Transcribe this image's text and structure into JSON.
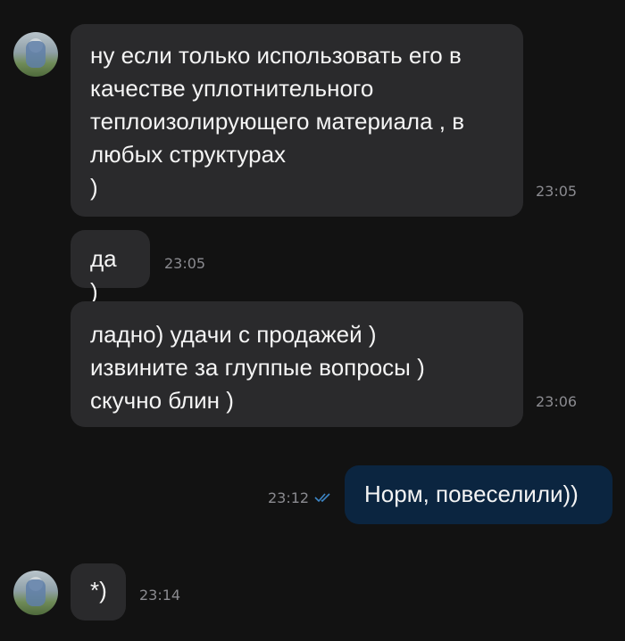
{
  "messages": [
    {
      "text": "ну если только использовать его в\nкачестве уплотнительного\nтеплоизолирующего материала , в\nлюбых структурах\n)",
      "time": "23:05"
    },
    {
      "text": "да )",
      "time": "23:05"
    },
    {
      "text": "ладно) удачи с продажей )\nизвините за глуппые  вопросы  )\nскучно блин )",
      "time": "23:06"
    },
    {
      "text": "Норм, повеселили))",
      "time": "23:12",
      "status": "read"
    },
    {
      "text": "*)",
      "time": "23:14"
    }
  ],
  "colors": {
    "background": "#121212",
    "incoming_bubble": "#2a2a2c",
    "outgoing_bubble": "#0b2540",
    "read_check": "#3d86c6",
    "timestamp": "#8b8b90"
  },
  "icons": {
    "read_status": "double-check-icon",
    "contact_avatar": "avatar"
  }
}
